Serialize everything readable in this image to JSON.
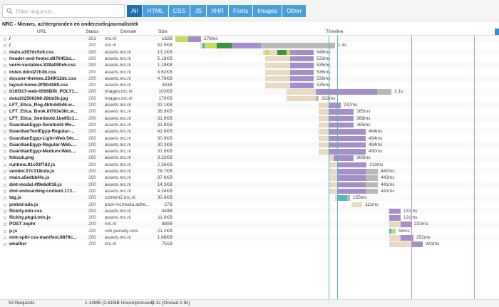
{
  "toolbar": {
    "filter_placeholder": "Filter requests...",
    "tabs": [
      "All",
      "HTML",
      "CSS",
      "JS",
      "XHR",
      "Fonts",
      "Images",
      "Other"
    ],
    "active_tab": "All"
  },
  "page_title": "NRC - Nieuws, achtergronden en onderzoeksjournalistiek",
  "columns": {
    "url": "URL",
    "status": "Status",
    "domain": "Domain",
    "size": "Size",
    "timeline": "Timeline"
  },
  "colors": {
    "blocking": "#e8d9c5",
    "dns": "#c4dd6a",
    "connect": "#9ac93a",
    "ssl": "#58b6c4",
    "send": "#3e8f3e",
    "wait": "#a58fc7",
    "receive": "#b9b9b9",
    "dom_line": "#58b6c4",
    "load_line": "#c98bd0"
  },
  "requests": [
    {
      "url": "/",
      "status": "301",
      "domain": "nrc.nl",
      "size": "162B",
      "duration": "278ms"
    },
    {
      "url": "/",
      "status": "200",
      "domain": "nrc.nl",
      "size": "52.5KB",
      "duration": "1.4s"
    },
    {
      "url": "main.a397dc5c8.css",
      "status": "200",
      "domain": "assets.nrc.nl",
      "size": "13.2KB",
      "duration": "548ms"
    },
    {
      "url": "header-and-footer.d876451d...",
      "status": "200",
      "domain": "assets.nrc.nl",
      "size": "5.18KB",
      "duration": "533ms"
    },
    {
      "url": "vorm-variables.839a090e5.css",
      "status": "200",
      "domain": "assets.nrc.nl",
      "size": "1.19KB",
      "duration": "535ms"
    },
    {
      "url": "index.ddcd27b3b.css",
      "status": "200",
      "domain": "assets.nrc.nl",
      "size": "8.62KB",
      "duration": "536ms"
    },
    {
      "url": "dossier-themes.2549f12dc.css",
      "status": "200",
      "domain": "assets.nrc.nl",
      "size": "4.76KB",
      "duration": "536ms"
    },
    {
      "url": "layout-home.9ff904089.css",
      "status": "200",
      "domain": "assets.nrc.nl",
      "size": "383B",
      "duration": "535ms"
    },
    {
      "url": "b16f317-web-0506BIN_POLY1...",
      "status": "200",
      "domain": "images.nrc.nl",
      "size": "103KB",
      "duration": "1.1s"
    },
    {
      "url": "data102506398-28bb5b.jpg",
      "status": "200",
      "domain": "images.nrc.nl",
      "size": "170KB",
      "duration": "322ms"
    },
    {
      "url": "LFT_Etica_Reg.4bfcdd546.w...",
      "status": "200",
      "domain": "assets.nrc.nl",
      "size": "32.1KB",
      "duration": "237ms"
    },
    {
      "url": "LFT_Etica_Book.8f783e38c.w...",
      "status": "200",
      "domain": "assets.nrc.nl",
      "size": "38.9KB",
      "duration": "365ms"
    },
    {
      "url": "LFT_Etica_Semibold.1be95c1...",
      "status": "200",
      "domain": "assets.nrc.nl",
      "size": "31.6KB",
      "duration": "368ms"
    },
    {
      "url": "GuardianEgyp-Semibold-We...",
      "status": "200",
      "domain": "assets.nrc.nl",
      "size": "31.9KB",
      "duration": "369ms"
    },
    {
      "url": "GuardianTextEgyp-Regular-...",
      "status": "200",
      "domain": "assets.nrc.nl",
      "size": "42.8KB",
      "duration": "494ms"
    },
    {
      "url": "GuardianEgyp-Light-Web.54c...",
      "status": "200",
      "domain": "assets.nrc.nl",
      "size": "30.9KB",
      "duration": "494ms"
    },
    {
      "url": "GuardianEgyp-Regular-Web....",
      "status": "200",
      "domain": "assets.nrc.nl",
      "size": "30.3KB",
      "duration": "494ms"
    },
    {
      "url": "GuardianEgyp-Medium-Web....",
      "status": "200",
      "domain": "assets.nrc.nl",
      "size": "31.9KB",
      "duration": "490ms"
    },
    {
      "url": "foksuk.png",
      "status": "200",
      "domain": "assets.nrc.nl",
      "size": "3.22KB",
      "duration": "269ms"
    },
    {
      "url": "runtime.81c03f7d2.js",
      "status": "200",
      "domain": "assets.nrc.nl",
      "size": "2.36KB",
      "duration": "318ms"
    },
    {
      "url": "vendor.07c318cda.js",
      "status": "200",
      "domain": "assets.nrc.nl",
      "size": "78.7KB",
      "duration": "440ms"
    },
    {
      "url": "main.a5edbbf4c.js",
      "status": "200",
      "domain": "assets.nrc.nl",
      "size": "87.6KB",
      "duration": "443ms"
    },
    {
      "url": "dmt-modal.4f9e6d016.js",
      "status": "200",
      "domain": "assets.nrc.nl",
      "size": "14.3KB",
      "duration": "441ms"
    },
    {
      "url": "dmt-onboarding-content.172...",
      "status": "200",
      "domain": "assets.nrc.nl",
      "size": "4.34KB",
      "duration": "441ms"
    },
    {
      "url": "tag.js",
      "status": "200",
      "domain": "content2.nrc.nl",
      "size": "30.8KB",
      "duration": "155ms"
    },
    {
      "url": "prebid-ads.js",
      "status": "200",
      "domain": "pool-nrcmedia.adhe...",
      "size": "27B",
      "duration": "111ms"
    },
    {
      "url": "flickity.min.css",
      "status": "200",
      "domain": "assets.nrc.nl",
      "size": "448B",
      "duration": "131ms"
    },
    {
      "url": "flickity.pkgd.min.js",
      "status": "200",
      "domain": "assets.nrc.nl",
      "size": "11.8KB",
      "duration": "131ms"
    },
    {
      "url": "POST zephr",
      "status": "200",
      "domain": "nrc.nl",
      "size": "880B",
      "duration": "233ms"
    },
    {
      "url": "p.js",
      "status": "200",
      "domain": "cdn.parsely.com",
      "size": "21.2KB",
      "duration": "58ms"
    },
    {
      "url": "nmt-split-css-manifest.8879c...",
      "status": "200",
      "domain": "assets.nrc.nl",
      "size": "1.88KB",
      "duration": "252ms"
    },
    {
      "url": "weather",
      "status": "200",
      "domain": "nrc.nl",
      "size": "751B",
      "duration": "341ms"
    }
  ],
  "footer": {
    "requests": "53 Requests",
    "transferred": "1.14MB  (2.81MB Uncompressed)",
    "time": "3.1s  (Onload 2.9s)"
  }
}
